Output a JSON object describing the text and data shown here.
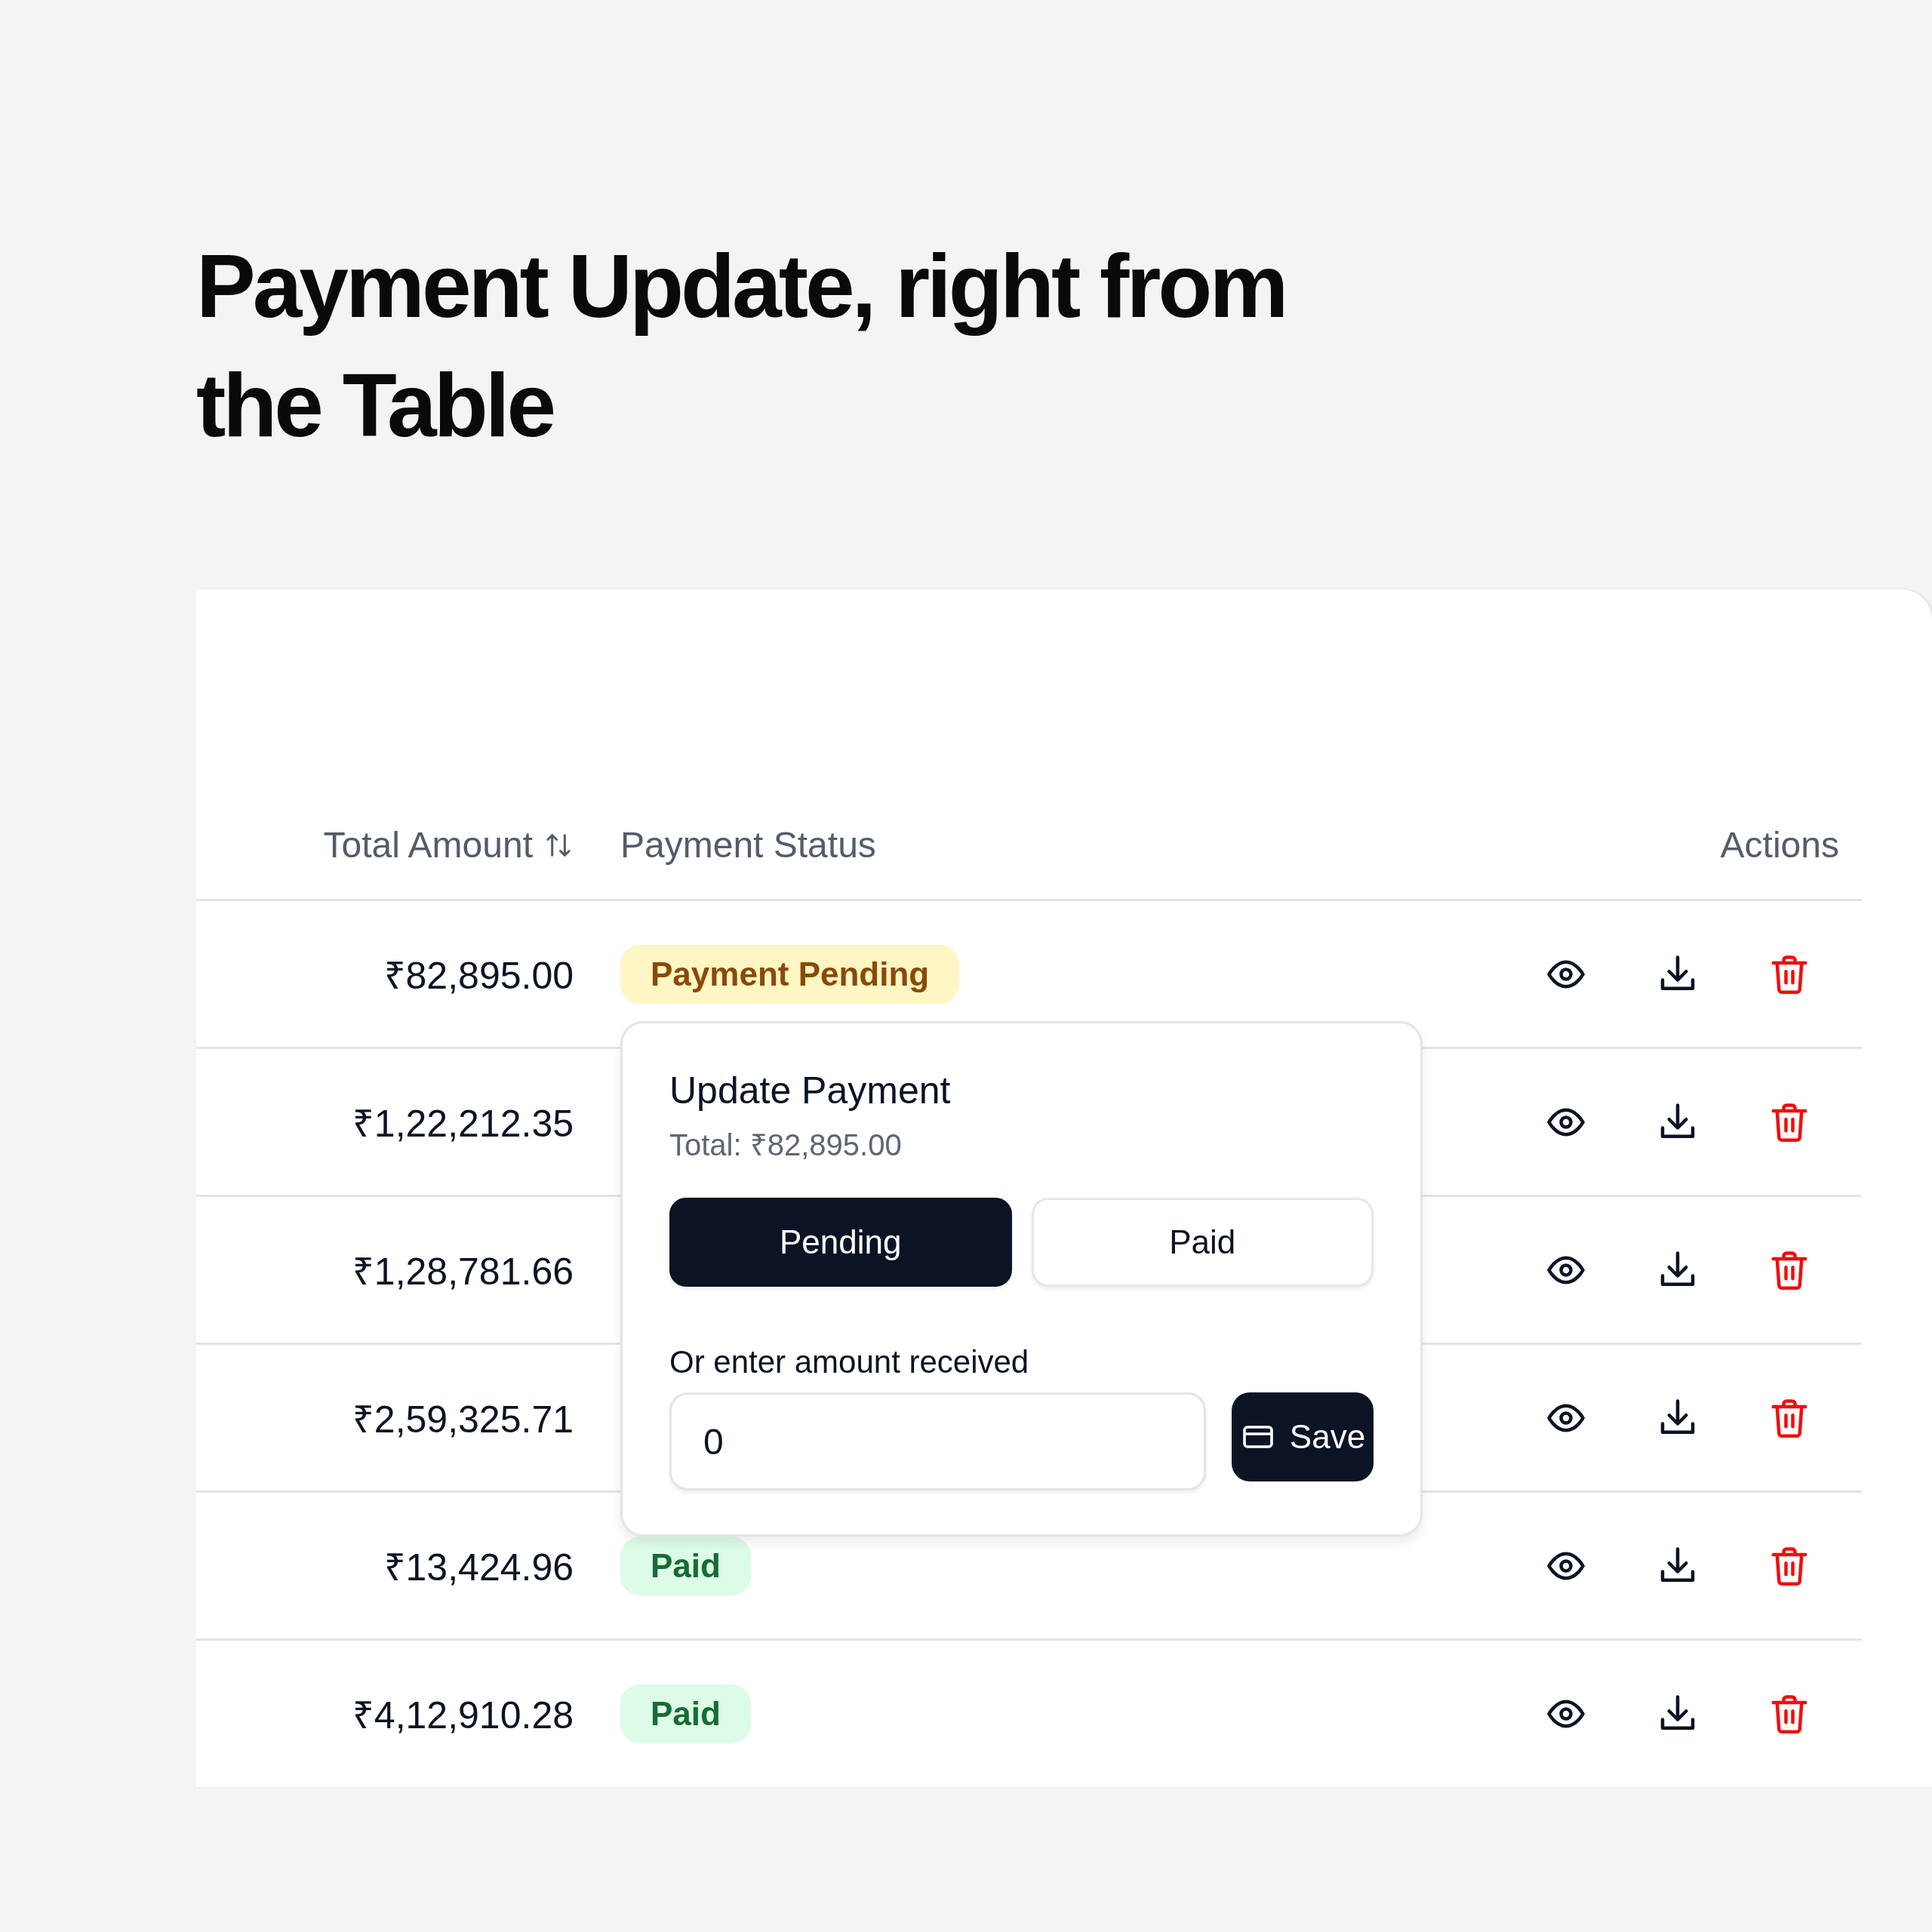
{
  "heading": "Payment Update, right from\nthe Table",
  "table": {
    "columns": [
      {
        "label": "Total Amount",
        "sortable": true
      },
      {
        "label": "Payment Status",
        "sortable": false
      },
      {
        "label": "Actions",
        "sortable": false
      }
    ],
    "rows": [
      {
        "amount": "₹82,895.00",
        "status": {
          "label": "Payment Pending",
          "kind": "pending"
        }
      },
      {
        "amount": "₹1,22,212.35"
      },
      {
        "amount": "₹1,28,781.66"
      },
      {
        "amount": "₹2,59,325.71"
      },
      {
        "amount": "₹13,424.96",
        "status": {
          "label": "Paid",
          "kind": "paid"
        }
      },
      {
        "amount": "₹4,12,910.28",
        "status": {
          "label": "Paid",
          "kind": "paid"
        }
      }
    ]
  },
  "popover": {
    "title": "Update Payment",
    "total": "Total: ₹82,895.00",
    "options": [
      {
        "label": "Pending",
        "selected": true
      },
      {
        "label": "Paid",
        "selected": false
      }
    ],
    "amount_label": "Or enter amount received",
    "amount_value": "0",
    "save": "Save"
  }
}
